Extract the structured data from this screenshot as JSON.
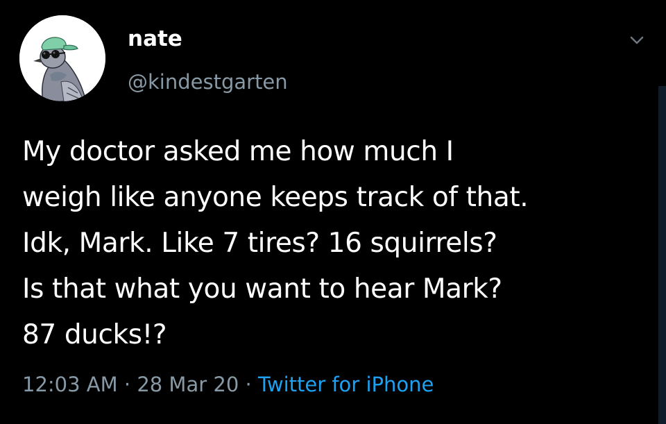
{
  "user": {
    "display_name": "nate",
    "handle": "@kindestgarten"
  },
  "tweet": {
    "lines": [
      "My doctor asked me how much I",
      "weigh like anyone keeps track of that.",
      "Idk, Mark. Like 7 tires? 16 squirrels?",
      "Is that what you want to hear Mark?",
      "87 ducks!?"
    ]
  },
  "meta": {
    "time": "12:03 AM",
    "separator": "·",
    "date": "28 Mar 20",
    "source": "Twitter for iPhone"
  },
  "icons": {
    "avatar": "pigeon-with-cap-and-sunglasses-avatar",
    "menu": "chevron-down-icon"
  },
  "colors": {
    "background": "#000000",
    "text_primary": "#ffffff",
    "text_secondary": "#8899a6",
    "link": "#1da1f2"
  }
}
